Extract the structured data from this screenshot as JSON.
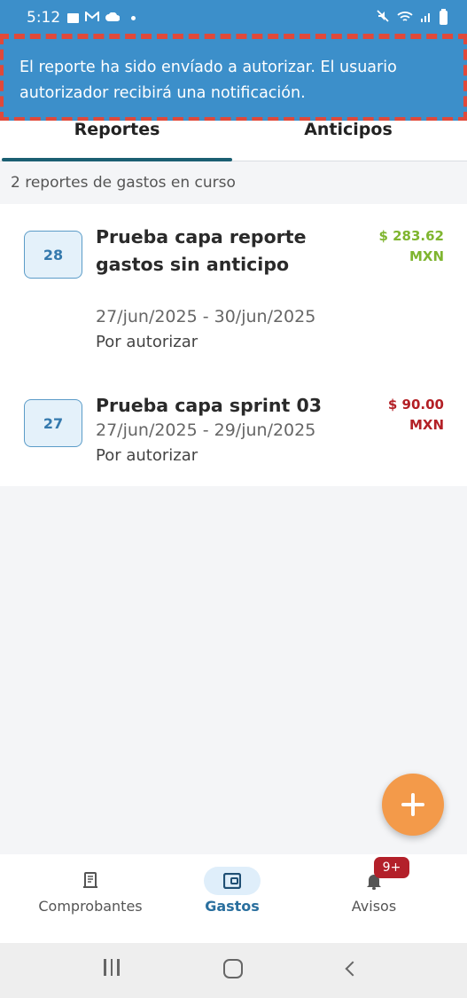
{
  "status_bar": {
    "time": "5:12"
  },
  "banner": {
    "message": "El reporte ha sido envíado a autorizar. El usuario autorizador recibirá una notificación."
  },
  "tabs": [
    {
      "label": "Reportes",
      "active": true
    },
    {
      "label": "Anticipos",
      "active": false
    }
  ],
  "summary": "2 reportes de gastos en curso",
  "reports": [
    {
      "id": "28",
      "title": "Prueba capa reporte gastos sin anticipo",
      "amount": "$ 283.62",
      "currency": "MXN",
      "amount_color": "#7fb52f",
      "dates": "27/jun/2025 - 30/jun/2025",
      "status": "Por autorizar"
    },
    {
      "id": "27",
      "title": "Prueba capa sprint 03",
      "amount": "$ 90.00",
      "currency": "MXN",
      "amount_color": "#b32026",
      "dates": "27/jun/2025 - 29/jun/2025",
      "status": "Por autorizar"
    }
  ],
  "fab": {
    "icon": "plus-icon"
  },
  "bottom_nav": {
    "items": [
      {
        "label": "Comprobantes",
        "icon": "receipt-icon",
        "active": false
      },
      {
        "label": "Gastos",
        "icon": "wallet-icon",
        "active": true
      },
      {
        "label": "Avisos",
        "icon": "bell-icon",
        "active": false,
        "badge": "9+"
      }
    ]
  },
  "colors": {
    "primary": "#3c8fca",
    "accent": "#f39a4a",
    "tab_indicator": "#1b5f72",
    "badge": "#b3202a"
  }
}
